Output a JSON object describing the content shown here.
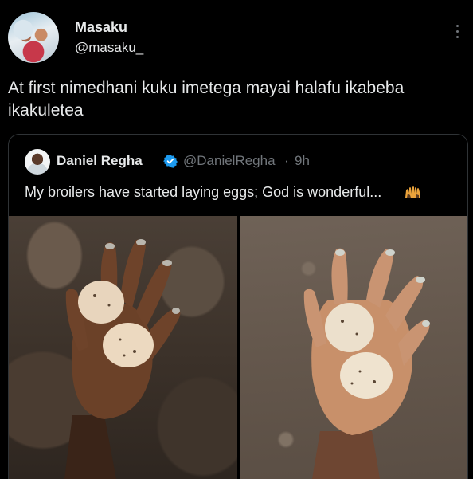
{
  "author": {
    "name": "Masaku",
    "handle": "@masaku_"
  },
  "tweet": {
    "text": "At first nimedhani kuku imetega mayai halafu ikabeba ikakuletea"
  },
  "quoted_tweet": {
    "name": "Daniel Regha",
    "handle": "@DanielRegha",
    "separator": "·",
    "time": "9h",
    "text": "My broilers have started laying eggs; God is wonderful...",
    "emoji": "raised-hands-emoji"
  },
  "icons": {
    "verified": "verified-badge-icon",
    "more": "more-options-icon"
  },
  "colors": {
    "background": "#000000",
    "text": "#e7e9ea",
    "secondary": "#71767b",
    "border": "#2f3336",
    "verified": "#1d9bf0"
  },
  "images": [
    {
      "name": "hand-with-eggs-photo-left",
      "egg_count": 2
    },
    {
      "name": "hand-with-eggs-photo-right",
      "egg_count": 2
    }
  ]
}
